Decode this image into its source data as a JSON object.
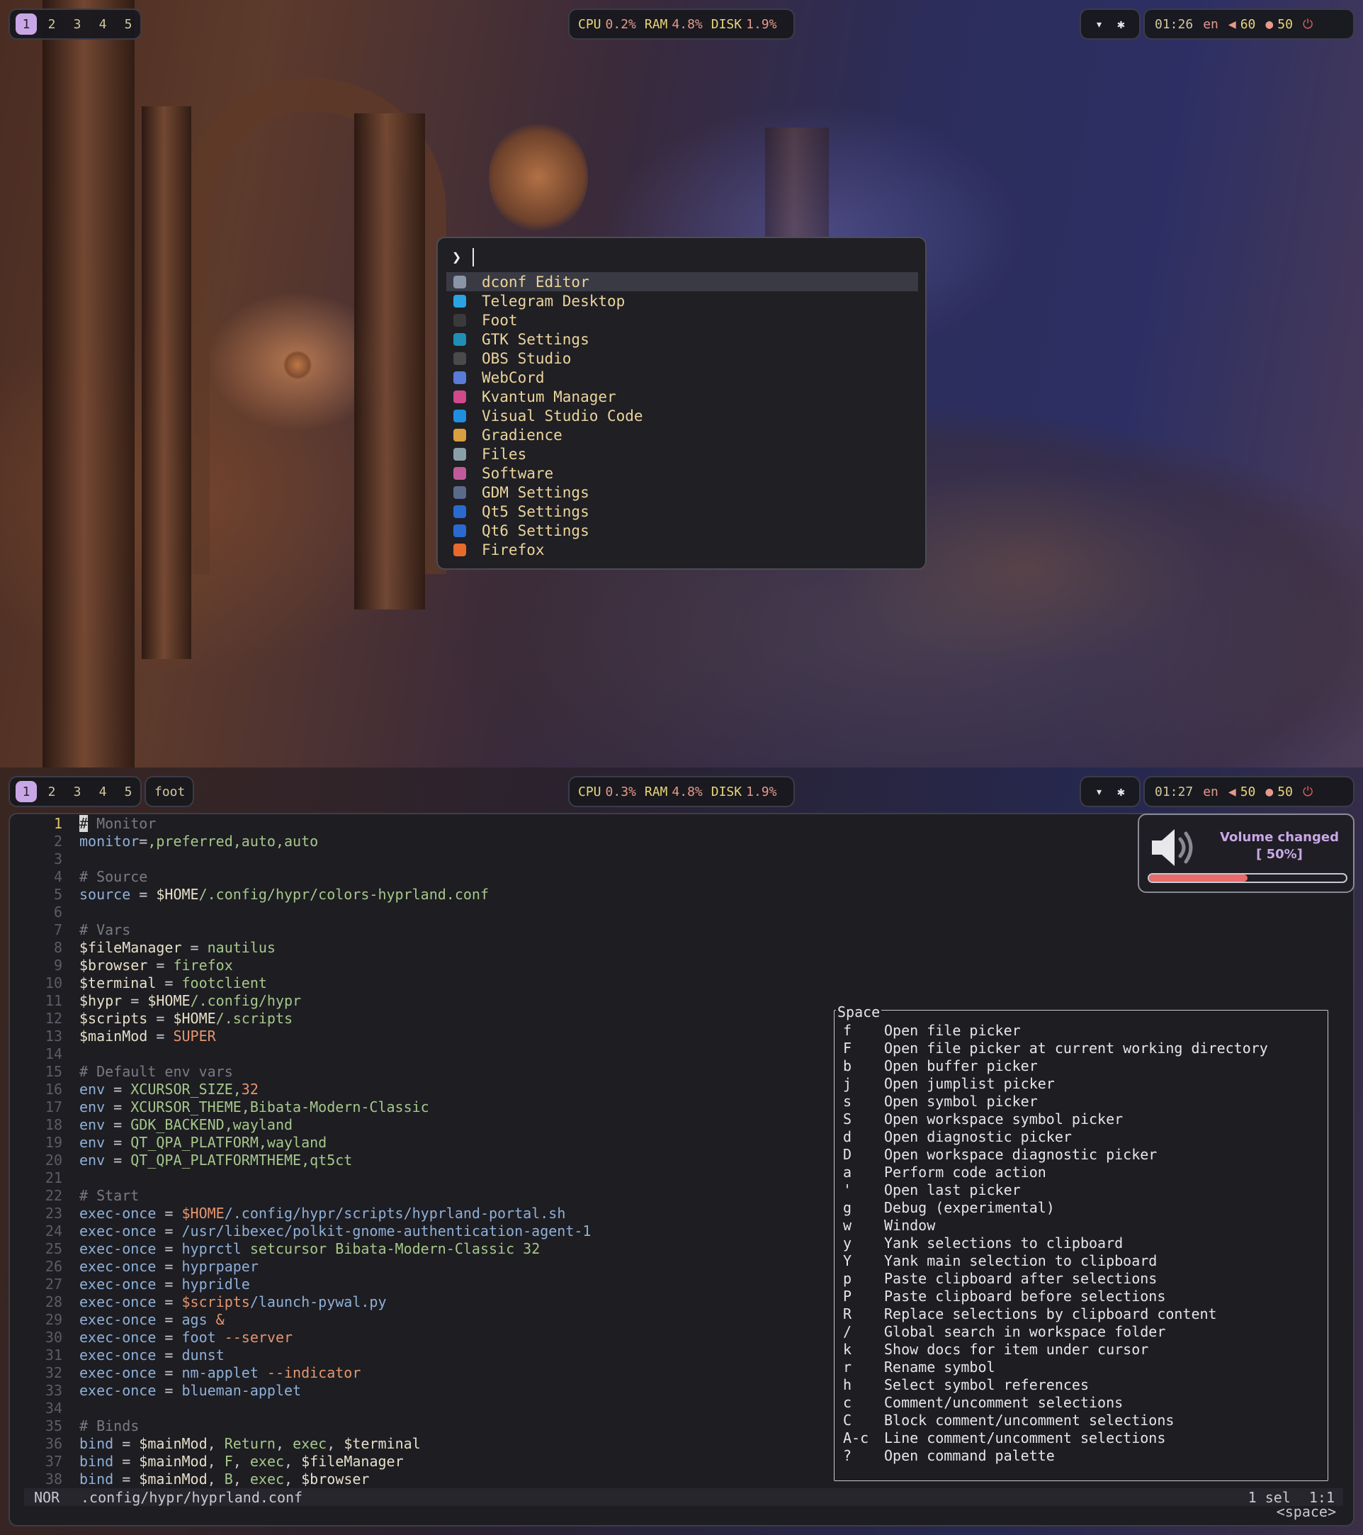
{
  "top_bar": {
    "workspaces": [
      "1",
      "2",
      "3",
      "4",
      "5"
    ],
    "active_workspace": "1",
    "cpu_label": "CPU",
    "cpu": "0.2%",
    "ram_label": "RAM",
    "ram": "4.8%",
    "disk_label": "DISK",
    "disk": "1.9%",
    "time": "01:26",
    "lang": "en",
    "volume": "60",
    "mic": "50"
  },
  "launcher": {
    "prompt_symbol": "❯",
    "apps": [
      {
        "name": "dconf Editor",
        "icon": "dconf-editor-icon",
        "color": "#8a96a8",
        "selected": true
      },
      {
        "name": "Telegram Desktop",
        "icon": "telegram-icon",
        "color": "#2aa3e0"
      },
      {
        "name": "Foot",
        "icon": "terminal-icon",
        "color": "#3a3a3a"
      },
      {
        "name": "GTK Settings",
        "icon": "gtk-settings-icon",
        "color": "#1f8fb5"
      },
      {
        "name": "OBS Studio",
        "icon": "obs-icon",
        "color": "#4a4a4a"
      },
      {
        "name": "WebCord",
        "icon": "discord-icon",
        "color": "#5a7bd8"
      },
      {
        "name": "Kvantum Manager",
        "icon": "kvantum-icon",
        "color": "#d04a8a"
      },
      {
        "name": "Visual Studio Code",
        "icon": "vscode-icon",
        "color": "#1f8fe0"
      },
      {
        "name": "Gradience",
        "icon": "gradience-icon",
        "color": "#d8a040"
      },
      {
        "name": "Files",
        "icon": "files-icon",
        "color": "#8aa0a8"
      },
      {
        "name": "Software",
        "icon": "software-icon",
        "color": "#c05a9a"
      },
      {
        "name": "GDM Settings",
        "icon": "gdm-settings-icon",
        "color": "#5a6a8a"
      },
      {
        "name": "Qt5 Settings",
        "icon": "qt5-settings-icon",
        "color": "#2a6ad0"
      },
      {
        "name": "Qt6 Settings",
        "icon": "qt6-settings-icon",
        "color": "#2a6ad0"
      },
      {
        "name": "Firefox",
        "icon": "firefox-icon",
        "color": "#e86a2a"
      }
    ]
  },
  "bottom_bar": {
    "workspaces": [
      "1",
      "2",
      "3",
      "4",
      "5"
    ],
    "active_workspace": "1",
    "window_title": "foot",
    "cpu_label": "CPU",
    "cpu": "0.3%",
    "ram_label": "RAM",
    "ram": "4.8%",
    "disk_label": "DISK",
    "disk": "1.9%",
    "time": "01:27",
    "lang": "en",
    "volume": "50",
    "mic": "50"
  },
  "editor": {
    "current_line": 1,
    "lines": [
      [
        [
          "c-comment",
          "# Monitor"
        ]
      ],
      [
        [
          "c-key",
          "monitor"
        ],
        [
          "txt",
          "="
        ],
        [
          "c-val",
          ",preferred,auto,auto"
        ]
      ],
      [],
      [
        [
          "c-comment",
          "# Source"
        ]
      ],
      [
        [
          "c-key",
          "source"
        ],
        [
          "txt",
          " = "
        ],
        [
          "c-var",
          "$HOME"
        ],
        [
          "c-val",
          "/.config/hypr/colors-hyprland.conf"
        ]
      ],
      [],
      [
        [
          "c-comment",
          "# Vars"
        ]
      ],
      [
        [
          "c-var",
          "$fileManager"
        ],
        [
          "txt",
          " = "
        ],
        [
          "c-val",
          "nautilus"
        ]
      ],
      [
        [
          "c-var",
          "$browser"
        ],
        [
          "txt",
          " = "
        ],
        [
          "c-val",
          "firefox"
        ]
      ],
      [
        [
          "c-var",
          "$terminal"
        ],
        [
          "txt",
          " = "
        ],
        [
          "c-val",
          "footclient"
        ]
      ],
      [
        [
          "c-var",
          "$hypr"
        ],
        [
          "txt",
          " = "
        ],
        [
          "c-var",
          "$HOME"
        ],
        [
          "c-val",
          "/.config/hypr"
        ]
      ],
      [
        [
          "c-var",
          "$scripts"
        ],
        [
          "txt",
          " = "
        ],
        [
          "c-var",
          "$HOME"
        ],
        [
          "c-val",
          "/.scripts"
        ]
      ],
      [
        [
          "c-var",
          "$mainMod"
        ],
        [
          "txt",
          " = "
        ],
        [
          "c-flag",
          "SUPER"
        ]
      ],
      [],
      [
        [
          "c-comment",
          "# Default env vars"
        ]
      ],
      [
        [
          "c-key",
          "env"
        ],
        [
          "txt",
          " = "
        ],
        [
          "c-val",
          "XCURSOR_SIZE,"
        ],
        [
          "c-flag",
          "32"
        ]
      ],
      [
        [
          "c-key",
          "env"
        ],
        [
          "txt",
          " = "
        ],
        [
          "c-val",
          "XCURSOR_THEME,Bibata-Modern-Classic"
        ]
      ],
      [
        [
          "c-key",
          "env"
        ],
        [
          "txt",
          " = "
        ],
        [
          "c-val",
          "GDK_BACKEND,wayland"
        ]
      ],
      [
        [
          "c-key",
          "env"
        ],
        [
          "txt",
          " = "
        ],
        [
          "c-val",
          "QT_QPA_PLATFORM,wayland"
        ]
      ],
      [
        [
          "c-key",
          "env"
        ],
        [
          "txt",
          " = "
        ],
        [
          "c-val",
          "QT_QPA_PLATFORMTHEME,qt5ct"
        ]
      ],
      [],
      [
        [
          "c-comment",
          "# Start"
        ]
      ],
      [
        [
          "c-key",
          "exec-once"
        ],
        [
          "txt",
          " = "
        ],
        [
          "c-flag",
          "$HOME"
        ],
        [
          "c-key",
          "/.config/hypr/scripts/hyprland-portal.sh"
        ]
      ],
      [
        [
          "c-key",
          "exec-once"
        ],
        [
          "txt",
          " = "
        ],
        [
          "c-key",
          "/usr/libexec/polkit-gnome-authentication-agent-1"
        ]
      ],
      [
        [
          "c-key",
          "exec-once"
        ],
        [
          "txt",
          " = "
        ],
        [
          "c-key",
          "hyprctl"
        ],
        [
          "c-val",
          " setcursor Bibata-Modern-Classic 32"
        ]
      ],
      [
        [
          "c-key",
          "exec-once"
        ],
        [
          "txt",
          " = "
        ],
        [
          "c-key",
          "hyprpaper"
        ]
      ],
      [
        [
          "c-key",
          "exec-once"
        ],
        [
          "txt",
          " = "
        ],
        [
          "c-key",
          "hypridle"
        ]
      ],
      [
        [
          "c-key",
          "exec-once"
        ],
        [
          "txt",
          " = "
        ],
        [
          "c-flag",
          "$scripts"
        ],
        [
          "c-key",
          "/launch-pywal.py"
        ]
      ],
      [
        [
          "c-key",
          "exec-once"
        ],
        [
          "txt",
          " = "
        ],
        [
          "c-key",
          "ags"
        ],
        [
          "c-flag",
          " &"
        ]
      ],
      [
        [
          "c-key",
          "exec-once"
        ],
        [
          "txt",
          " = "
        ],
        [
          "c-key",
          "foot"
        ],
        [
          "c-flag",
          " --server"
        ]
      ],
      [
        [
          "c-key",
          "exec-once"
        ],
        [
          "txt",
          " = "
        ],
        [
          "c-key",
          "dunst"
        ]
      ],
      [
        [
          "c-key",
          "exec-once"
        ],
        [
          "txt",
          " = "
        ],
        [
          "c-key",
          "nm-applet"
        ],
        [
          "c-flag",
          " --indicator"
        ]
      ],
      [
        [
          "c-key",
          "exec-once"
        ],
        [
          "txt",
          " = "
        ],
        [
          "c-key",
          "blueman-applet"
        ]
      ],
      [],
      [
        [
          "c-comment",
          "# Binds"
        ]
      ],
      [
        [
          "c-key",
          "bind"
        ],
        [
          "txt",
          " = "
        ],
        [
          "c-var",
          "$mainMod"
        ],
        [
          "txt",
          ", "
        ],
        [
          "c-val",
          "Return"
        ],
        [
          "txt",
          ", "
        ],
        [
          "c-val",
          "exec"
        ],
        [
          "txt",
          ", "
        ],
        [
          "c-var",
          "$terminal"
        ]
      ],
      [
        [
          "c-key",
          "bind"
        ],
        [
          "txt",
          " = "
        ],
        [
          "c-var",
          "$mainMod"
        ],
        [
          "txt",
          ", "
        ],
        [
          "c-val",
          "F"
        ],
        [
          "txt",
          ", "
        ],
        [
          "c-val",
          "exec"
        ],
        [
          "txt",
          ", "
        ],
        [
          "c-var",
          "$fileManager"
        ]
      ],
      [
        [
          "c-key",
          "bind"
        ],
        [
          "txt",
          " = "
        ],
        [
          "c-var",
          "$mainMod"
        ],
        [
          "txt",
          ", "
        ],
        [
          "c-val",
          "B"
        ],
        [
          "txt",
          ", "
        ],
        [
          "c-val",
          "exec"
        ],
        [
          "txt",
          ", "
        ],
        [
          "c-var",
          "$browser"
        ]
      ]
    ]
  },
  "statusline": {
    "mode": "NOR",
    "file": ".config/hypr/hyprland.conf",
    "selection": "1 sel",
    "position": "1:1",
    "pending_keys": "<space>"
  },
  "space_popup": {
    "title": "Space",
    "hints": [
      [
        "f",
        "Open file picker"
      ],
      [
        "F",
        "Open file picker at current working directory"
      ],
      [
        "b",
        "Open buffer picker"
      ],
      [
        "j",
        "Open jumplist picker"
      ],
      [
        "s",
        "Open symbol picker"
      ],
      [
        "S",
        "Open workspace symbol picker"
      ],
      [
        "d",
        "Open diagnostic picker"
      ],
      [
        "D",
        "Open workspace diagnostic picker"
      ],
      [
        "a",
        "Perform code action"
      ],
      [
        "'",
        "Open last picker"
      ],
      [
        "g",
        "Debug (experimental)"
      ],
      [
        "w",
        "Window"
      ],
      [
        "y",
        "Yank selections to clipboard"
      ],
      [
        "Y",
        "Yank main selection to clipboard"
      ],
      [
        "p",
        "Paste clipboard after selections"
      ],
      [
        "P",
        "Paste clipboard before selections"
      ],
      [
        "R",
        "Replace selections by clipboard content"
      ],
      [
        "/",
        "Global search in workspace folder"
      ],
      [
        "k",
        "Show docs for item under cursor"
      ],
      [
        "r",
        "Rename symbol"
      ],
      [
        "h",
        "Select symbol references"
      ],
      [
        "c",
        "Comment/uncomment selections"
      ],
      [
        "C",
        "Block comment/uncomment selections"
      ],
      [
        "A-c",
        "Line comment/uncomment selections"
      ],
      [
        "?",
        "Open command palette"
      ]
    ]
  },
  "osd": {
    "title": "Volume changed",
    "value_text": "[ 50%]",
    "level": 0.5,
    "icon": "speaker-icon"
  }
}
